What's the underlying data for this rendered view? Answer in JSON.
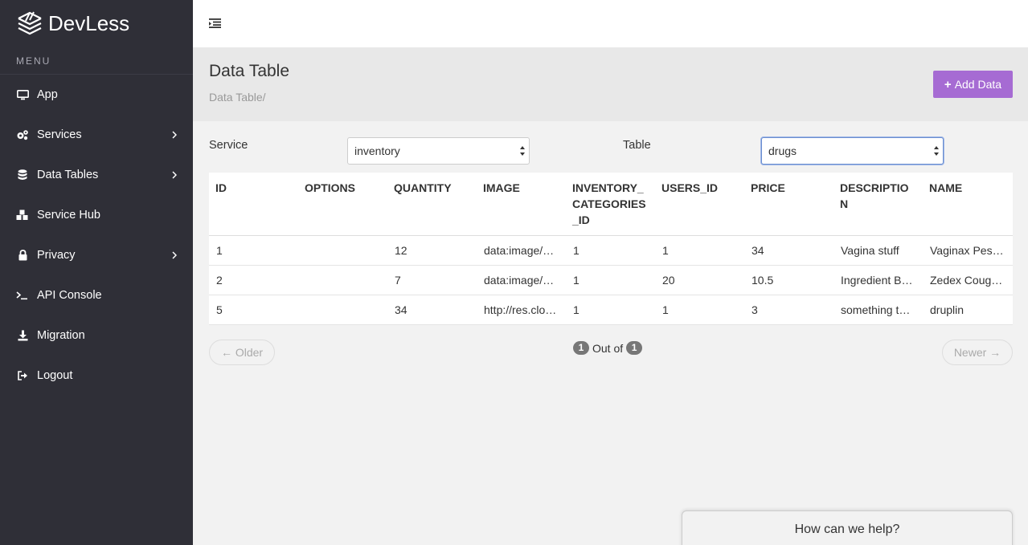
{
  "brand": {
    "name": "DevLess"
  },
  "sidebar": {
    "menu_label": "MENU",
    "items": [
      {
        "label": "App",
        "icon": "monitor-icon",
        "has_submenu": false
      },
      {
        "label": "Services",
        "icon": "cogs-icon",
        "has_submenu": true
      },
      {
        "label": "Data Tables",
        "icon": "database-icon",
        "has_submenu": true
      },
      {
        "label": "Service Hub",
        "icon": "cubes-icon",
        "has_submenu": false
      },
      {
        "label": "Privacy",
        "icon": "lock-icon",
        "has_submenu": true
      },
      {
        "label": "API Console",
        "icon": "terminal-icon",
        "has_submenu": false
      },
      {
        "label": "Migration",
        "icon": "download-icon",
        "has_submenu": false
      },
      {
        "label": "Logout",
        "icon": "sign-out-icon",
        "has_submenu": false
      }
    ]
  },
  "header": {
    "title": "Data Table",
    "breadcrumb": "Data Table/",
    "add_button": "Add Data"
  },
  "filters": {
    "service_label": "Service",
    "service_value": "inventory",
    "table_label": "Table",
    "table_value": "drugs"
  },
  "table": {
    "columns": [
      "ID",
      "OPTIONS",
      "QUANTITY",
      "IMAGE",
      "INVENTORY_CATEGORIES_ID",
      "USERS_ID",
      "PRICE",
      "DESCRIPTION",
      "NAME"
    ],
    "rows": [
      [
        "1",
        "",
        "12",
        "data:image/p…",
        "1",
        "1",
        "34",
        "Vagina stuff",
        "Vaginax Pes…"
      ],
      [
        "2",
        "",
        "7",
        "data:image/p…",
        "1",
        "20",
        "10.5",
        "Ingredient Br…",
        "Zedex Coug…"
      ],
      [
        "5",
        "",
        "34",
        "http://res.clo…",
        "1",
        "1",
        "3",
        "something to…",
        "druplin"
      ]
    ]
  },
  "pager": {
    "older": "← Older",
    "newer": "Newer →",
    "current": "1",
    "out_of": "Out of",
    "total": "1"
  },
  "help": {
    "label": "How can we help?"
  },
  "colors": {
    "sidebar_bg": "#2f2f37",
    "accent": "#a66bd3",
    "header_bg": "#e8e8e8",
    "page_bg": "#f2f2f2"
  }
}
